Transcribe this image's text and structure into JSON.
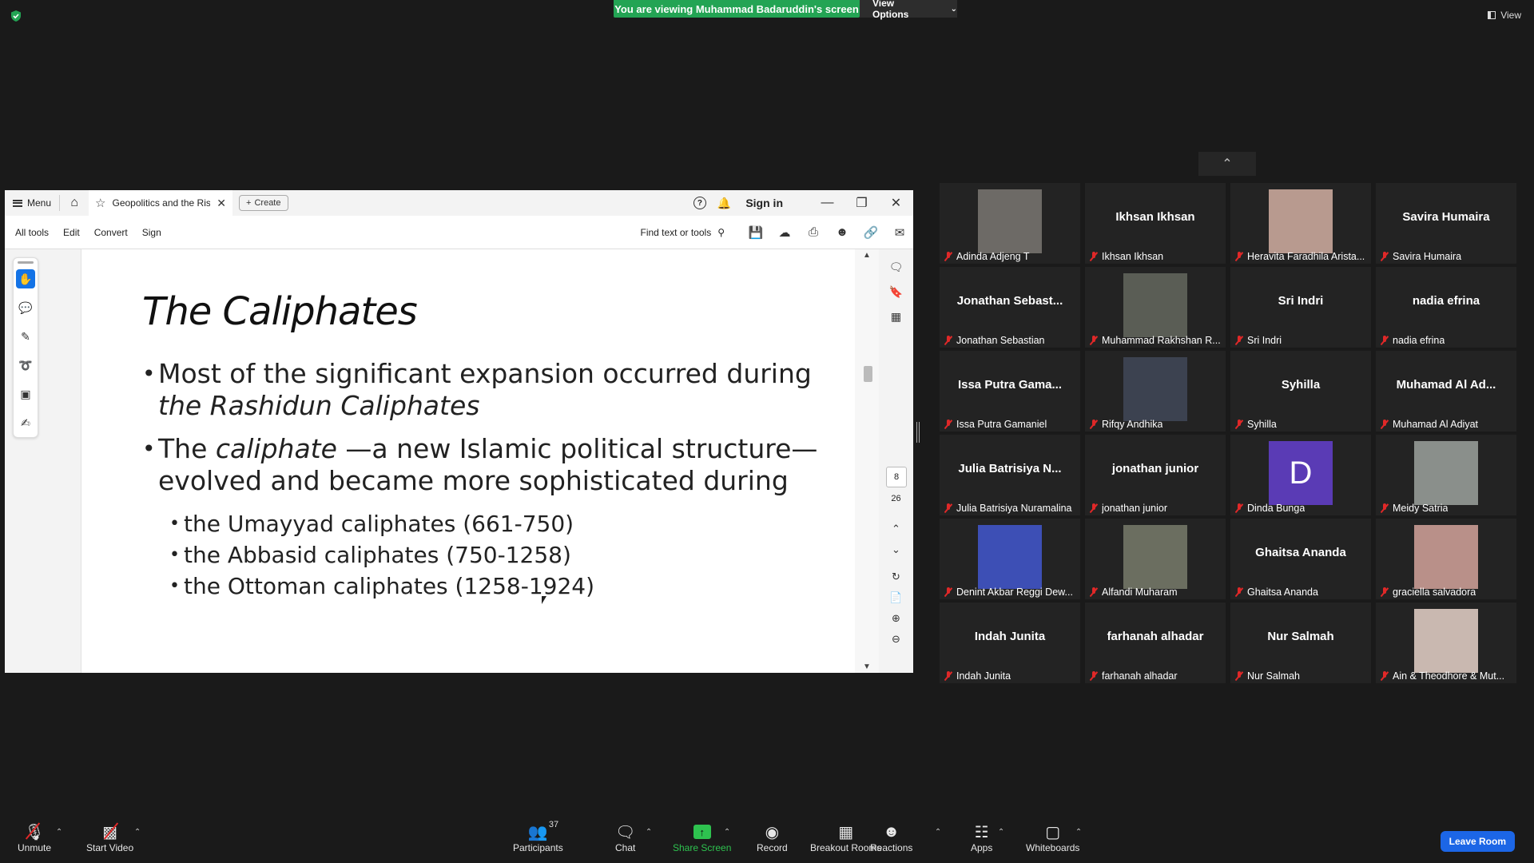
{
  "banner": {
    "viewing": "You are viewing Muhammad Badaruddin's screen",
    "view_options": "View Options",
    "view": "View"
  },
  "acrobat": {
    "menu_label": "Menu",
    "tab_title": "Geopolitics and the Ris...",
    "create_label": "Create",
    "sign_in": "Sign in",
    "toolbar": [
      "All tools",
      "Edit",
      "Convert",
      "Sign"
    ],
    "find_label": "Find text or tools",
    "page_current": "8",
    "page_total": "26"
  },
  "slide": {
    "title": "The Caliphates",
    "b1_line1": "Most of the significant expansion occurred during",
    "b1_line2": "the Rashidun Caliphates",
    "b2_pre": "The ",
    "b2_italic": "caliphate",
    "b2_post": " —a new Islamic political structure—",
    "b2_line2": "evolved and became more sophisticated during",
    "sub": [
      "the Umayyad caliphates (661-750)",
      "the Abbasid caliphates (750-1258)",
      "the Ottoman caliphates (1258-1924)"
    ]
  },
  "participants": [
    {
      "label": "Adinda Adjeng T",
      "tile": "photo",
      "color": "#6d6a66"
    },
    {
      "label": "Ikhsan Ikhsan",
      "tile": "Ikhsan Ikhsan"
    },
    {
      "label": "Heravita Faradhila Arista...",
      "tile": "photo",
      "color": "#b89a8f"
    },
    {
      "label": "Savira Humaira",
      "tile": "Savira Humaira"
    },
    {
      "label": "Jonathan Sebastian",
      "tile": "Jonathan  Sebast..."
    },
    {
      "label": "Muhammad Rakhshan R...",
      "tile": "photo",
      "color": "#5a5d55"
    },
    {
      "label": "Sri Indri",
      "tile": "Sri Indri"
    },
    {
      "label": "nadia efrina",
      "tile": "nadia efrina"
    },
    {
      "label": "Issa Putra Gamaniel",
      "tile": "Issa Putra Gama..."
    },
    {
      "label": "Rifqy Andhika",
      "tile": "photo",
      "color": "#3c4250"
    },
    {
      "label": "Syhilla",
      "tile": "Syhilla"
    },
    {
      "label": "Muhamad Al Adiyat",
      "tile": "Muhamad Al Ad..."
    },
    {
      "label": "Julia Batrisiya Nuramalina",
      "tile": "Julia Batrisiya N..."
    },
    {
      "label": "jonathan junior",
      "tile": "jonathan junior"
    },
    {
      "label": "Dinda Bunga",
      "tile": "D"
    },
    {
      "label": "Meidy Satria",
      "tile": "photo",
      "color": "#8a8f8b"
    },
    {
      "label": "Denint Akbar Reggi Dew...",
      "tile": "photo",
      "color": "#3d4fb5"
    },
    {
      "label": "Alfandi Muharam",
      "tile": "photo",
      "color": "#6b6e60"
    },
    {
      "label": "Ghaitsa Ananda",
      "tile": "Ghaitsa Ananda"
    },
    {
      "label": "graciella salvadora",
      "tile": "photo",
      "color": "#b99089"
    },
    {
      "label": "Indah Junita",
      "tile": "Indah Junita"
    },
    {
      "label": "farhanah alhadar",
      "tile": "farhanah alhadar"
    },
    {
      "label": "Nur Salmah",
      "tile": "Nur Salmah"
    },
    {
      "label": "Ain & Theodhore & Mut...",
      "tile": "photo",
      "color": "#c9b8b0"
    }
  ],
  "controls": {
    "unmute": "Unmute",
    "start_video": "Start Video",
    "participants": "Participants",
    "participant_count": "37",
    "chat": "Chat",
    "share_screen": "Share Screen",
    "record": "Record",
    "breakout_rooms": "Breakout Rooms",
    "reactions": "Reactions",
    "apps": "Apps",
    "whiteboards": "Whiteboards",
    "leave": "Leave Room"
  }
}
